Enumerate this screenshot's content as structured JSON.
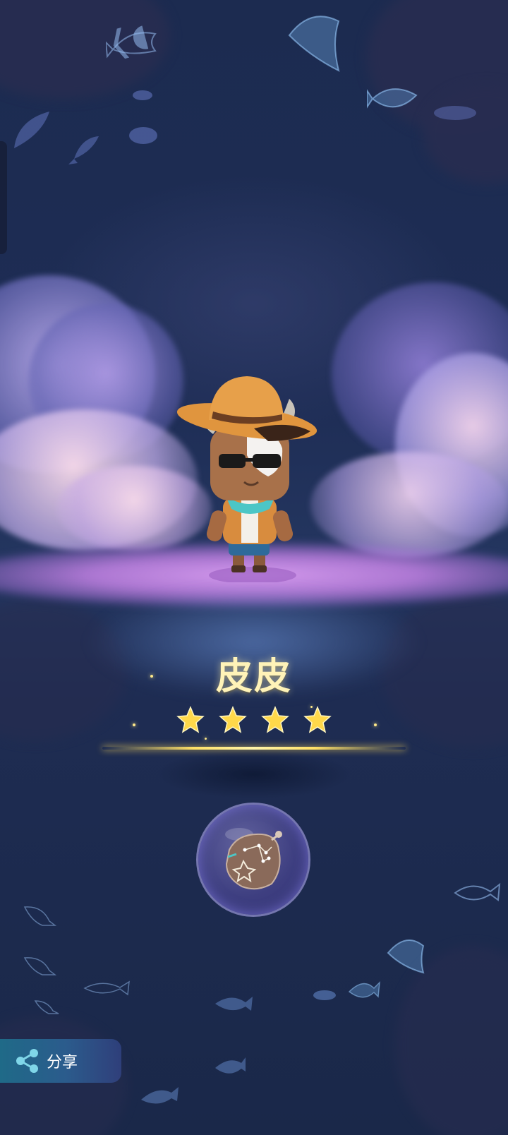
{
  "pet": {
    "name": "皮皮",
    "rating": 4,
    "rating_max": 4
  },
  "share": {
    "label": "分享",
    "icon": "share-icon"
  },
  "colors": {
    "background": "#1c2b50",
    "floor_glow": "#dea0f5",
    "name_text": "#fff3b8",
    "star": "#ffd84a",
    "share_button": "#1f6a88"
  }
}
